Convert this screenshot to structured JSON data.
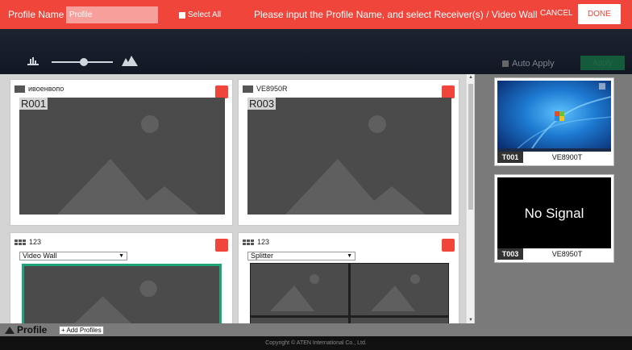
{
  "header": {
    "profile_name_label": "Profile Name",
    "profile_name_value": "Profile",
    "select_all_label": "Select All",
    "message": "Please input the Profile Name, and select Receiver(s) / Video Wall",
    "cancel_label": "CANCEL",
    "done_label": "DONE"
  },
  "toolbar": {
    "auto_apply_label": "Auto Apply",
    "apply_label": "Apply",
    "zoom_level": 0.5
  },
  "receivers": [
    {
      "name": "ивоенвопо",
      "label": "R001",
      "icon": "monitor-icon"
    },
    {
      "name": "VE8950R",
      "label": "R003",
      "icon": "monitor-icon"
    },
    {
      "name": "123",
      "mode": "Video Wall",
      "icon": "video-wall-icon"
    },
    {
      "name": "123",
      "mode": "Splitter",
      "icon": "video-wall-icon"
    }
  ],
  "transmitters": [
    {
      "id": "T001",
      "name": "VE8900T",
      "signal": "desktop"
    },
    {
      "id": "T003",
      "name": "VE8950T",
      "signal_text": "No Signal"
    }
  ],
  "profile_bar": {
    "label": "Profile",
    "add_label": "+ Add Profiles"
  },
  "footer": {
    "copyright": "Copyright © ATEN International Co., Ltd."
  },
  "colors": {
    "accent": "#f0453b",
    "selected_border": "#1fa47a",
    "apply_green": "#165a3c"
  }
}
